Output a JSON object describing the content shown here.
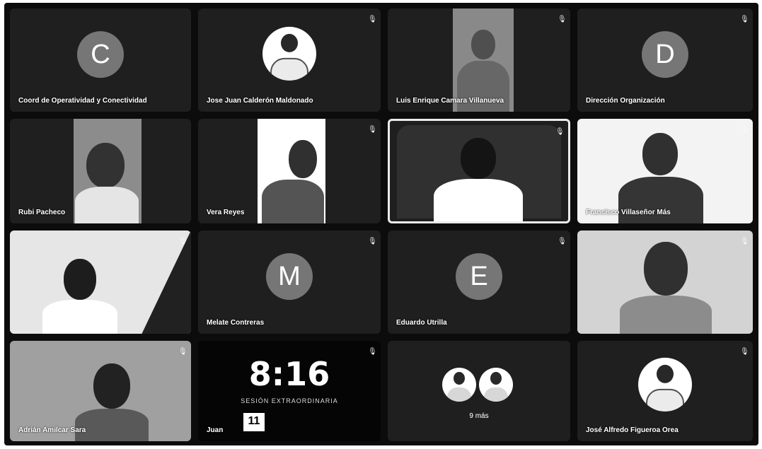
{
  "meeting": {
    "tiles": [
      {
        "name": "Coord de Operatividad y Conectividad",
        "avatar_letter": "C",
        "kind": "letter"
      },
      {
        "name": "Jose Juan Calderón Maldonado",
        "kind": "photo"
      },
      {
        "name": "Luis Enrique Camara Villanueva",
        "kind": "video"
      },
      {
        "name": "Dirección Organización",
        "avatar_letter": "D",
        "kind": "letter"
      },
      {
        "name": "Rubi Pacheco",
        "kind": "video"
      },
      {
        "name": "Vera Reyes",
        "kind": "video"
      },
      {
        "name": "",
        "kind": "video"
      },
      {
        "name": "Francisco Villaseñor Más",
        "kind": "video"
      },
      {
        "name": "",
        "kind": "video"
      },
      {
        "name": "Melate Contreras",
        "avatar_letter": "M",
        "kind": "letter"
      },
      {
        "name": "Eduardo Utrilla",
        "avatar_letter": "E",
        "kind": "letter"
      },
      {
        "name": "",
        "kind": "video"
      },
      {
        "name": "Adrián Amilcar Sara",
        "kind": "video"
      },
      {
        "name": "Juan",
        "kind": "clock"
      },
      {
        "name": "",
        "kind": "more"
      },
      {
        "name": "José Alfredo Figueroa Orea",
        "kind": "photo"
      }
    ],
    "clock": {
      "time": "8:16",
      "caption": "SESIÓN EXTRAORDINARIA",
      "calendar_day": "11"
    },
    "more_label": "9 más"
  },
  "icons": {
    "mic": "mic-muted-icon"
  }
}
